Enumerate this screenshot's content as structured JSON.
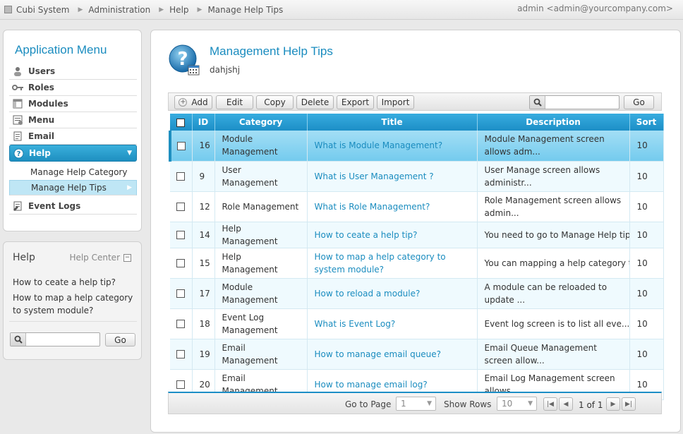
{
  "topbar": {
    "breadcrumbs": [
      "Cubi System",
      "Administration",
      "Help",
      "Manage Help Tips"
    ],
    "user": "admin <admin@yourcompany.com>"
  },
  "menu": {
    "title": "Application Menu",
    "items": [
      {
        "label": "Users",
        "icon": "users-icon"
      },
      {
        "label": "Roles",
        "icon": "key-icon"
      },
      {
        "label": "Modules",
        "icon": "modules-icon"
      },
      {
        "label": "Menu",
        "icon": "menu-icon"
      },
      {
        "label": "Email",
        "icon": "email-icon"
      },
      {
        "label": "Help",
        "icon": "help-icon"
      },
      {
        "label": "Event Logs",
        "icon": "event-logs-icon"
      }
    ],
    "help_sub": [
      "Manage Help Category",
      "Manage Help Tips"
    ]
  },
  "help_box": {
    "title": "Help",
    "center": "Help Center",
    "links": [
      "How to ceate a help tip?",
      "How to map a help category to system module?"
    ],
    "go": "Go",
    "search_value": ""
  },
  "page": {
    "title": "Management Help Tips",
    "subtitle": "dahjshj"
  },
  "toolbar": {
    "add": "Add",
    "edit": "Edit",
    "copy": "Copy",
    "delete": "Delete",
    "export": "Export",
    "import": "Import",
    "go": "Go",
    "search_value": ""
  },
  "grid": {
    "columns": [
      "ID",
      "Category",
      "Title",
      "Description",
      "Sort"
    ],
    "rows": [
      {
        "id": "16",
        "category": "Module Management",
        "title": "What is Module Management?",
        "description": "Module Management screen allows adm...",
        "sort": "10"
      },
      {
        "id": "9",
        "category": "User Management",
        "title": "What is User Management ?",
        "description": "User Manage screen allows administr...",
        "sort": "10"
      },
      {
        "id": "12",
        "category": "Role Management",
        "title": "What is Role Management?",
        "description": "Role Management screen allows admin...",
        "sort": "10"
      },
      {
        "id": "14",
        "category": "Help Management",
        "title": "How to ceate a help tip?",
        "description": "You need to go to Manage Help tips...",
        "sort": "10"
      },
      {
        "id": "15",
        "category": "Help Management",
        "title": "How to map a help category to system module?",
        "description": "You can mapping a help category to...",
        "sort": "10"
      },
      {
        "id": "17",
        "category": "Module Management",
        "title": "How to reload a module?",
        "description": "A module can be reloaded to update ...",
        "sort": "10"
      },
      {
        "id": "18",
        "category": "Event Log Management",
        "title": "What is Event Log?",
        "description": "Event log screen is to list all eve...",
        "sort": "10"
      },
      {
        "id": "19",
        "category": "Email Management",
        "title": "How to manage email queue?",
        "description": "Email Queue Management screen allow...",
        "sort": "10"
      },
      {
        "id": "20",
        "category": "Email Management",
        "title": "How to manage email log?",
        "description": "Email Log Management screen allows ...",
        "sort": "10"
      }
    ]
  },
  "pager": {
    "goto_label": "Go to Page",
    "goto_value": "1",
    "rows_label": "Show Rows",
    "rows_value": "10",
    "info": "1 of 1"
  },
  "colors": {
    "accent": "#1a8cbf",
    "header": "#1c8ec6",
    "selected_row": "#8fd6f2"
  }
}
